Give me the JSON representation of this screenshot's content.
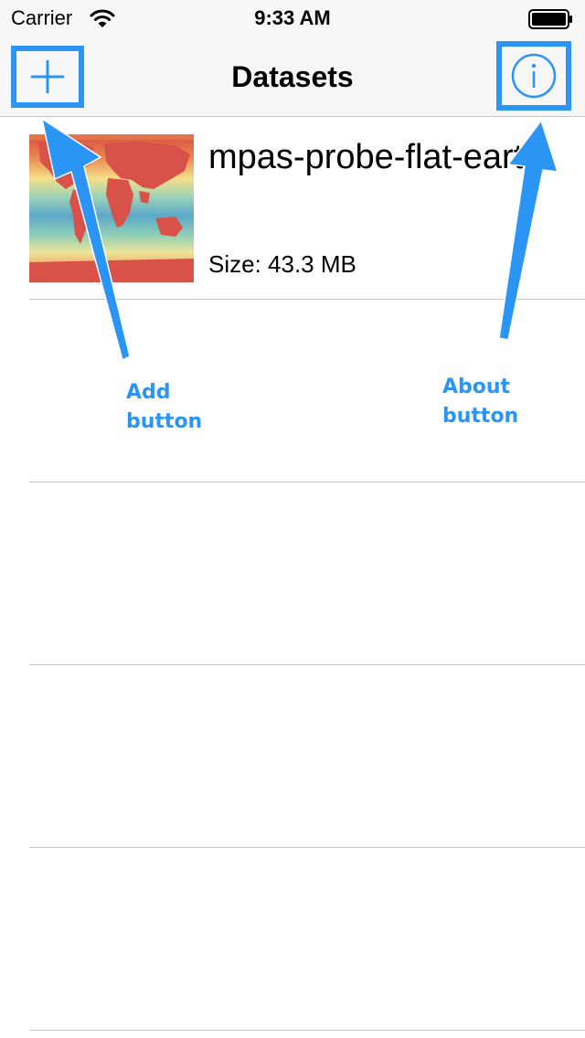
{
  "status_bar": {
    "carrier": "Carrier",
    "time": "9:33 AM",
    "icons": [
      "wifi-icon",
      "battery-icon"
    ]
  },
  "nav_bar": {
    "title": "Datasets",
    "left_button_icon": "plus-icon",
    "right_button_icon": "info-icon"
  },
  "datasets": [
    {
      "name": "mpas-probe-flat-earth",
      "size": "Size: 43.3 MB",
      "thumbnail_icon": "world-map-thumbnail"
    }
  ],
  "annotations": {
    "add": {
      "line1": "Add",
      "line2": "button"
    },
    "about": {
      "line1": "About",
      "line2": "button"
    }
  },
  "colors": {
    "accent": "#2b95f5",
    "annotation": "#2b95f5",
    "separator": "#c8c7cc",
    "bar_background": "#f7f7f7"
  }
}
